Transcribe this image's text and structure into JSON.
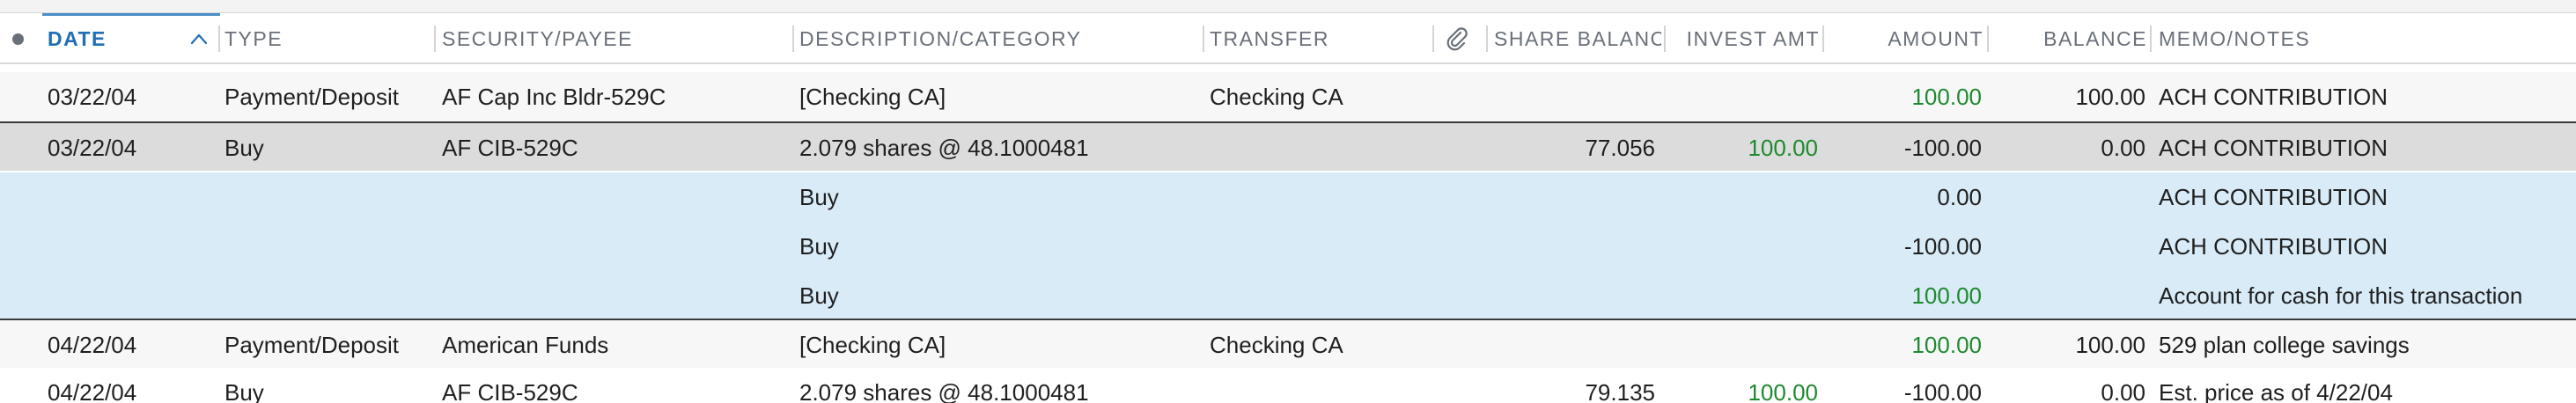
{
  "header": {
    "date": "DATE",
    "type": "TYPE",
    "security": "SECURITY/PAYEE",
    "description": "DESCRIPTION/CATEGORY",
    "transfer": "TRANSFER",
    "share_balance": "SHARE BALANCE",
    "invest_amt": "INVEST AMT",
    "amount": "AMOUNT",
    "balance": "BALANCE",
    "memo": "MEMO/NOTES",
    "sort_direction": "ascending"
  },
  "colors": {
    "accent": "#1f6fb2",
    "positive": "#1e8a2e",
    "split_row": "#d9ebf7",
    "selected_row": "#dcdcdc"
  },
  "icons": {
    "status": "status-dot-icon",
    "sort": "chevron-up-icon",
    "attachment": "paperclip-icon"
  },
  "rows": [
    {
      "date": "03/22/04",
      "type": "Payment/Deposit",
      "security": "AF Cap Inc Bldr-529C",
      "description": "[Checking CA]",
      "transfer": "Checking CA",
      "share_balance": "",
      "invest_amt": "",
      "amount": "100.00",
      "balance": "100.00",
      "memo": "ACH CONTRIBUTION"
    },
    {
      "date": "03/22/04",
      "type": "Buy",
      "security": "AF CIB-529C",
      "description": "2.079 shares @ 48.1000481",
      "transfer": "",
      "share_balance": "77.056",
      "invest_amt": "100.00",
      "amount": "-100.00",
      "balance": "0.00",
      "memo": "ACH CONTRIBUTION"
    },
    {
      "date": "",
      "type": "",
      "security": "",
      "description": "Buy",
      "transfer": "",
      "share_balance": "",
      "invest_amt": "",
      "amount": "0.00",
      "balance": "",
      "memo": "ACH CONTRIBUTION"
    },
    {
      "date": "",
      "type": "",
      "security": "",
      "description": "Buy",
      "transfer": "",
      "share_balance": "",
      "invest_amt": "",
      "amount": "-100.00",
      "balance": "",
      "memo": "ACH CONTRIBUTION"
    },
    {
      "date": "",
      "type": "",
      "security": "",
      "description": "Buy",
      "transfer": "",
      "share_balance": "",
      "invest_amt": "",
      "amount": "100.00",
      "balance": "",
      "memo": "Account for cash for this transaction"
    },
    {
      "date": "04/22/04",
      "type": "Payment/Deposit",
      "security": "American Funds",
      "description": "[Checking CA]",
      "transfer": "Checking CA",
      "share_balance": "",
      "invest_amt": "",
      "amount": "100.00",
      "balance": "100.00",
      "memo": "529 plan college savings"
    },
    {
      "date": "04/22/04",
      "type": "Buy",
      "security": "AF CIB-529C",
      "description": "2.079 shares @ 48.1000481",
      "transfer": "",
      "share_balance": "79.135",
      "invest_amt": "100.00",
      "amount": "-100.00",
      "balance": "0.00",
      "memo": "Est. price as of 4/22/04"
    }
  ]
}
